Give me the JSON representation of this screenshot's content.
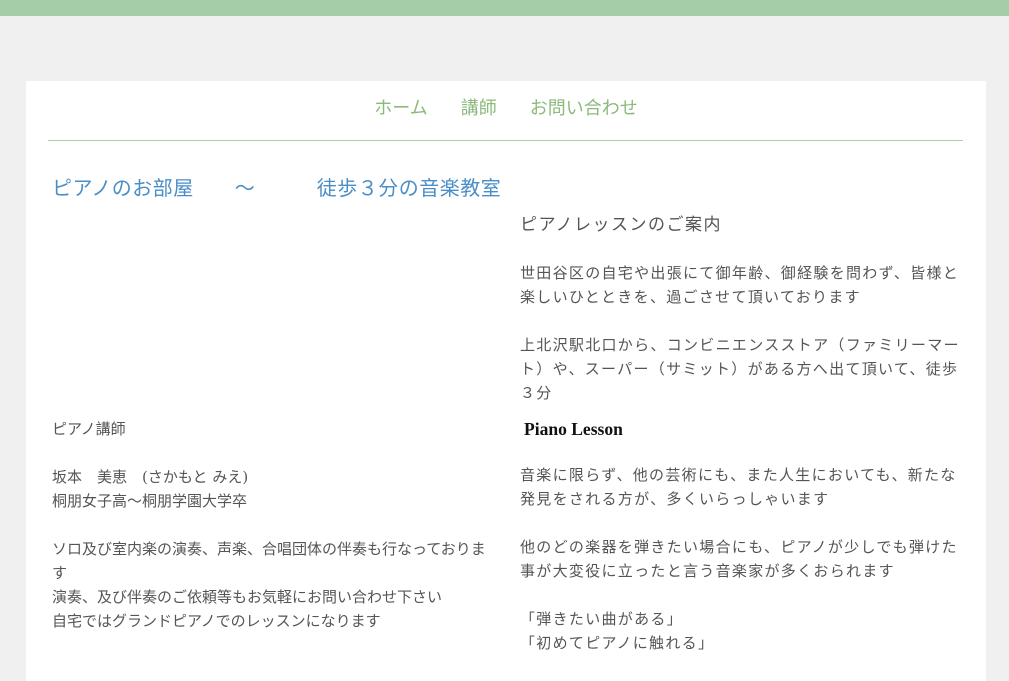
{
  "nav": {
    "items": [
      {
        "label": "ホーム"
      },
      {
        "label": "講師"
      },
      {
        "label": "お問い合わせ"
      }
    ]
  },
  "site_title": "ピアノのお部屋　　〜　　　徒歩３分の音楽教室",
  "teacher": {
    "heading": "ピアノ講師",
    "name": "坂本　美恵　(さかもと みえ)",
    "education": "桐朋女子高〜桐朋学園大学卒",
    "bio1": "ソロ及び室内楽の演奏、声楽、合唱団体の伴奏も行なっております",
    "bio2": "演奏、及び伴奏のご依頼等もお気軽にお問い合わせ下さい",
    "bio3": "自宅ではグランドピアノでのレッスンになります"
  },
  "lesson_info": {
    "title": "ピアノレッスンのご案内",
    "para1": "世田谷区の自宅や出張にて御年齢、御経験を問わず、皆様と楽しいひとときを、過ごさせて頂いております",
    "para2": "上北沢駅北口から、コンビニエンスストア（ファミリーマート）や、スーパー（サミット）がある方へ出て頂いて、徒歩３分"
  },
  "piano_lesson": {
    "title": "Piano Lesson",
    "para1": "音楽に限らず、他の芸術にも、また人生においても、新たな発見をされる方が、多くいらっしゃいます",
    "para2": "他のどの楽器を弾きたい場合にも、ピアノが少しでも弾けた事が大変役に立ったと言う音楽家が多くおられます",
    "quote1": "「弾きたい曲がある」",
    "quote2": "「初めてピアノに触れる」"
  },
  "colors": {
    "top_band": "#a5cda8",
    "nav_text": "#8cba7c",
    "title_blue": "#4a8ec8",
    "background": "#f0f0f0"
  }
}
